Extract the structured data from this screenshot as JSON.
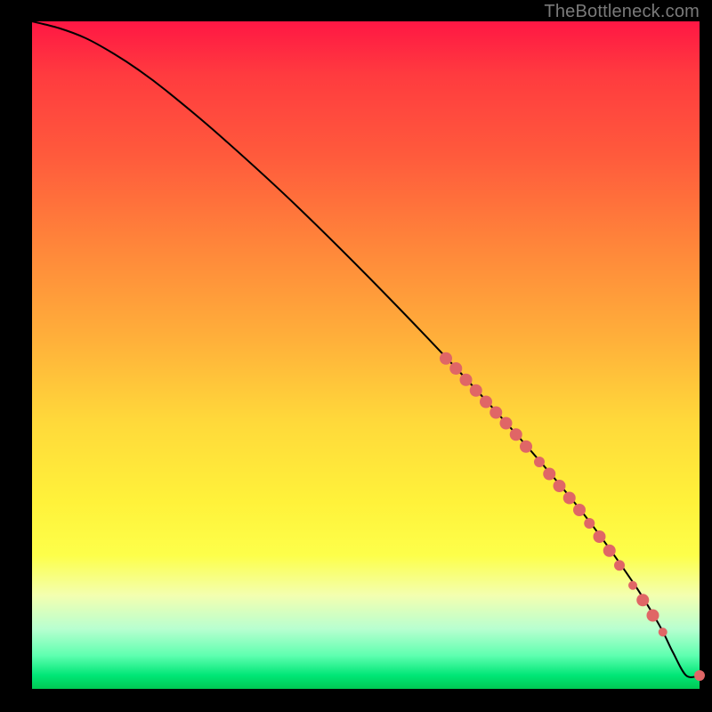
{
  "watermark": "TheBottleneck.com",
  "chart_data": {
    "type": "line",
    "title": "",
    "xlabel": "",
    "ylabel": "",
    "xlim": [
      0,
      100
    ],
    "ylim": [
      0,
      100
    ],
    "curve": {
      "x": [
        0,
        4,
        8,
        12,
        16,
        20,
        28,
        40,
        55,
        70,
        82,
        90,
        94,
        96,
        98,
        100
      ],
      "y": [
        100,
        99,
        97.5,
        95.3,
        92.7,
        89.7,
        83,
        72,
        57,
        41,
        27,
        16,
        9.5,
        5.5,
        2,
        2
      ]
    },
    "markers": {
      "color": "#e06666",
      "radius_small": 5,
      "radius_large": 7,
      "points": [
        {
          "x": 62,
          "y": 49.5,
          "r": 7
        },
        {
          "x": 63.5,
          "y": 48,
          "r": 7
        },
        {
          "x": 65,
          "y": 46.3,
          "r": 7
        },
        {
          "x": 66.5,
          "y": 44.7,
          "r": 7
        },
        {
          "x": 68,
          "y": 43,
          "r": 7
        },
        {
          "x": 69.5,
          "y": 41.4,
          "r": 7
        },
        {
          "x": 71,
          "y": 39.8,
          "r": 7
        },
        {
          "x": 72.5,
          "y": 38.1,
          "r": 7
        },
        {
          "x": 74,
          "y": 36.3,
          "r": 7
        },
        {
          "x": 76,
          "y": 34,
          "r": 6
        },
        {
          "x": 77.5,
          "y": 32.2,
          "r": 7
        },
        {
          "x": 79,
          "y": 30.4,
          "r": 7
        },
        {
          "x": 80.5,
          "y": 28.6,
          "r": 7
        },
        {
          "x": 82,
          "y": 26.8,
          "r": 7
        },
        {
          "x": 83.5,
          "y": 24.8,
          "r": 6
        },
        {
          "x": 85,
          "y": 22.8,
          "r": 7
        },
        {
          "x": 86.5,
          "y": 20.7,
          "r": 7
        },
        {
          "x": 88,
          "y": 18.5,
          "r": 6
        },
        {
          "x": 90,
          "y": 15.5,
          "r": 5
        },
        {
          "x": 91.5,
          "y": 13.3,
          "r": 7
        },
        {
          "x": 93,
          "y": 11,
          "r": 7
        },
        {
          "x": 94.5,
          "y": 8.5,
          "r": 5
        },
        {
          "x": 100,
          "y": 2,
          "r": 6
        }
      ]
    }
  }
}
